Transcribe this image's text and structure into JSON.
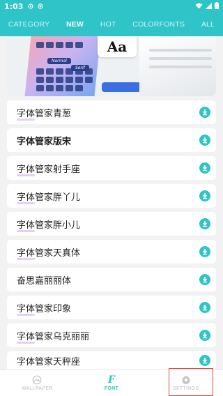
{
  "status_bar": {
    "time": "1:03"
  },
  "tabs": [
    {
      "label": "CATEGORY",
      "active": false
    },
    {
      "label": "NEW",
      "active": true
    },
    {
      "label": "HOT",
      "active": false
    },
    {
      "label": "COLORFONTS",
      "active": false
    },
    {
      "label": "ALL",
      "active": false
    }
  ],
  "banner": {
    "aa_text": "Aa",
    "chip_normal": "Normal",
    "chip_serif": "Serif"
  },
  "fonts": [
    {
      "label": "字体管家青葱"
    },
    {
      "label": "字体管家版宋"
    },
    {
      "label": "字体管家射手座"
    },
    {
      "label": "字体管家胖丫儿"
    },
    {
      "label": "字体管家胖小儿"
    },
    {
      "label": "字体管家天真体"
    },
    {
      "label": "奋思嘉丽丽体"
    },
    {
      "label": "字体管家印象"
    },
    {
      "label": "字体管家乌克丽丽"
    },
    {
      "label": "字体管家天秤座"
    }
  ],
  "bottom_nav": [
    {
      "label": "WALLPAPER",
      "icon": "wallpaper-icon",
      "active": false
    },
    {
      "label": "FONT",
      "icon": "font-icon",
      "active": true
    },
    {
      "label": "SETTINGS",
      "icon": "gear-icon",
      "active": false
    }
  ],
  "colors": {
    "accent": "#2ec4c8",
    "highlight": "#e0433c",
    "background": "#f2f2f2"
  }
}
